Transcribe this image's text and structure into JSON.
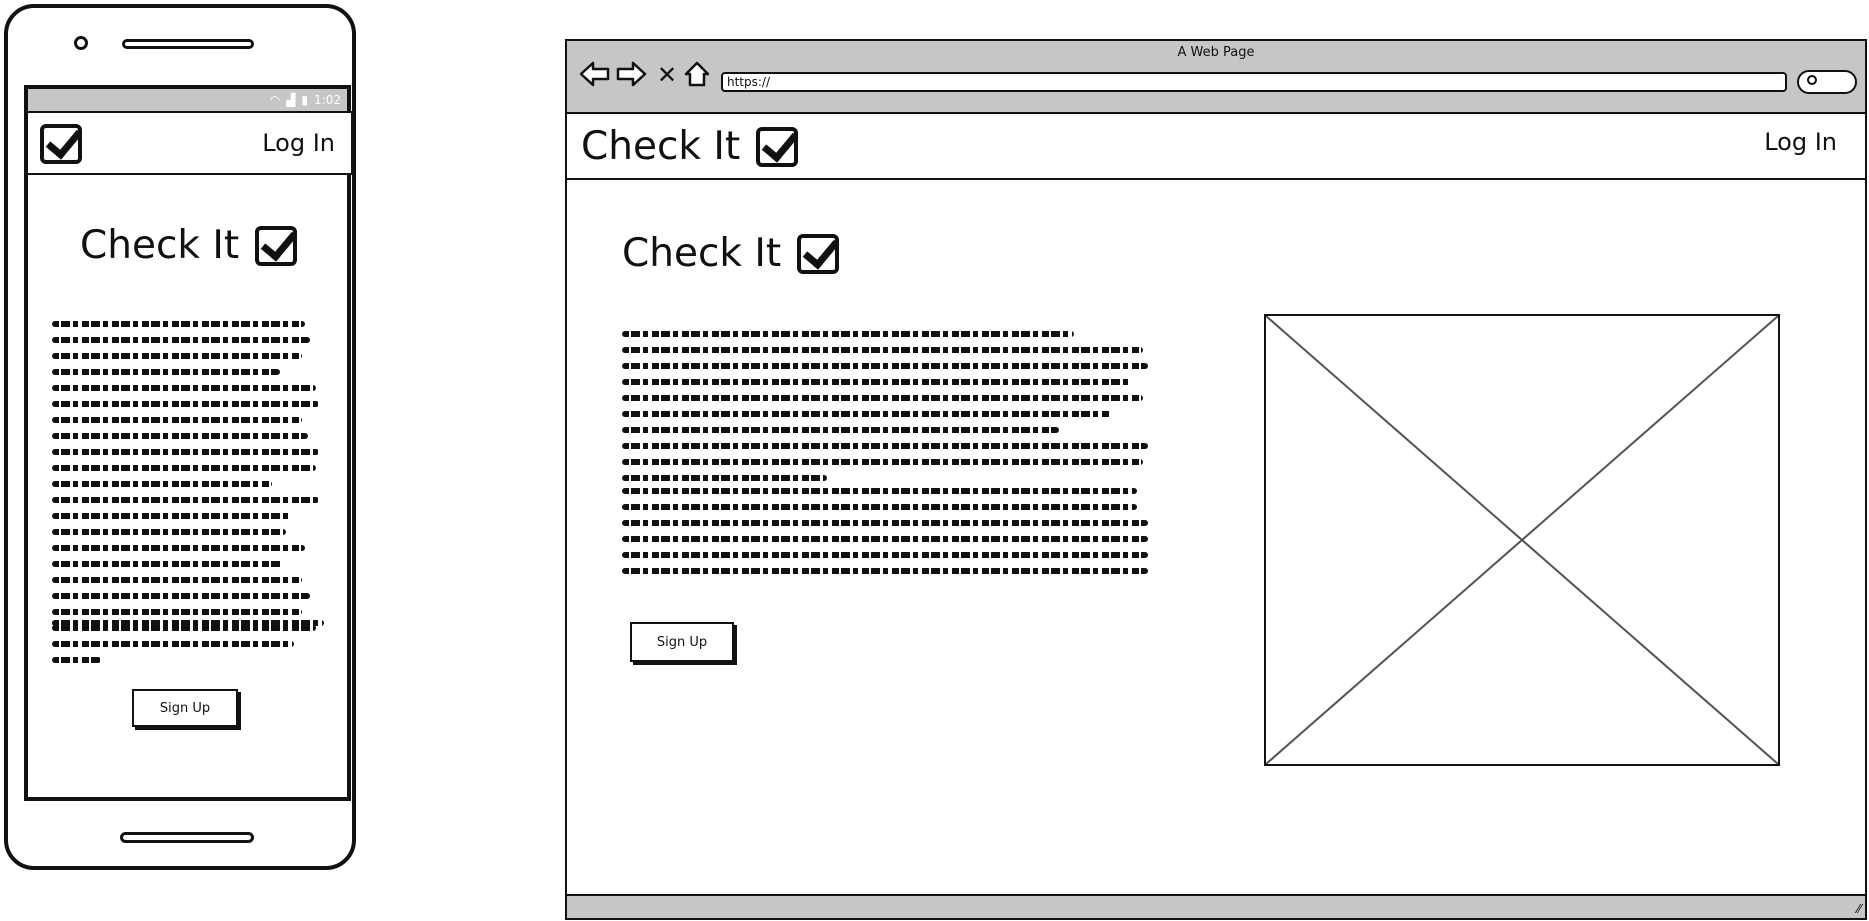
{
  "phone": {
    "status_time": "1:02",
    "header": {
      "login_label": "Log In"
    },
    "hero": {
      "title": "Check It"
    },
    "signup_label": "Sign Up",
    "paragraph_1_lines": [
      0.93,
      0.95,
      0.92,
      0.84,
      0.97,
      0.98,
      0.92,
      0.94,
      0.98,
      0.97,
      0.81,
      0.98,
      0.88,
      0.86,
      0.93,
      0.85,
      0.92,
      0.95,
      0.92,
      0.97,
      0.89,
      0.18
    ],
    "paragraph_2_lines": [
      1.0
    ]
  },
  "browser": {
    "title": "A Web Page",
    "url": "https://",
    "header": {
      "brand": "Check It",
      "login_label": "Log In"
    },
    "hero": {
      "title": "Check It"
    },
    "signup_label": "Sign Up",
    "paragraph_1_lines": [
      0.86,
      0.99,
      1.0,
      0.97,
      0.99,
      0.93,
      0.83,
      1.0,
      0.99,
      0.39
    ],
    "paragraph_2_lines": [
      0.98,
      0.98,
      1.0,
      1.0,
      1.0,
      1.0
    ]
  },
  "colors": {
    "chrome_gray": "#c6c6c6",
    "ink": "#111111"
  },
  "icons": [
    "back-arrow-icon",
    "forward-arrow-icon",
    "stop-icon",
    "home-icon",
    "search-icon",
    "checkbox-icon",
    "wifi-icon",
    "signal-icon",
    "battery-icon"
  ]
}
